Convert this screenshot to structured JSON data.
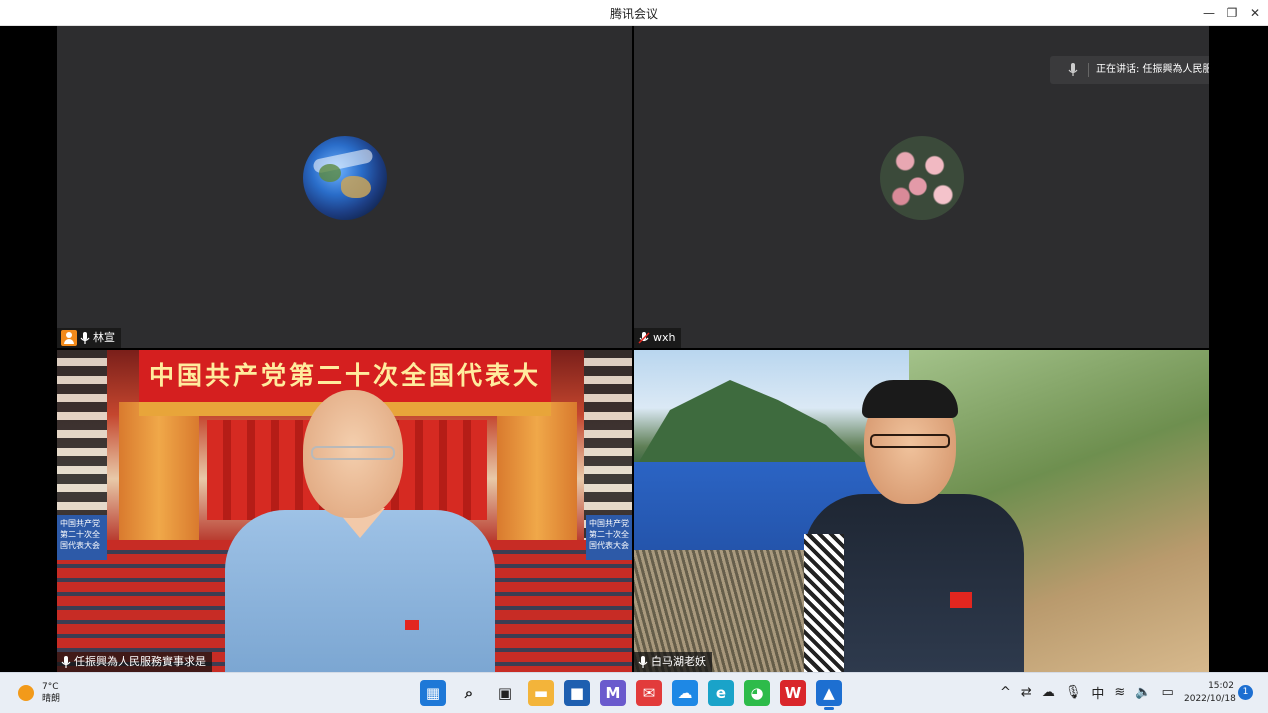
{
  "window": {
    "title": "腾讯会议",
    "minimize_glyph": "—",
    "maximize_glyph": "❐",
    "close_glyph": "✕"
  },
  "speaking": {
    "label": "正在讲话: 任振興為人民服務實..."
  },
  "participants": [
    {
      "name": "林宣",
      "avatar": "earth-avatar",
      "is_host": true
    },
    {
      "name": "wxh",
      "avatar": "flower-avatar",
      "is_host": false
    },
    {
      "name": "任振興為人民服務實事求是",
      "video": "congress-hall-background",
      "is_host": false
    },
    {
      "name": "白马湖老妖",
      "video": "lakeside-background",
      "is_host": false
    }
  ],
  "scene": {
    "banner": "中国共产党第二十次全国代表大会",
    "sign_left": "中国共产党第二十次全国代表大会",
    "sign_right": "中国共产党第二十次全国代表大会"
  },
  "taskbar": {
    "weather_temp": "7°C",
    "weather_desc": "晴朗",
    "apps": [
      {
        "name": "start-icon",
        "glyph": "▦",
        "color": "#1e78d7"
      },
      {
        "name": "search-icon",
        "glyph": "⌕",
        "color": "#222222"
      },
      {
        "name": "task-view-icon",
        "glyph": "▣",
        "color": "#222222"
      },
      {
        "name": "file-explorer-icon",
        "glyph": "▬",
        "color": "#f3b43a"
      },
      {
        "name": "store-icon",
        "glyph": "■",
        "color": "#1e5fb0"
      },
      {
        "name": "app-m-icon",
        "glyph": "M",
        "color": "#6a5acd"
      },
      {
        "name": "mail-app-icon",
        "glyph": "✉",
        "color": "#e23b3b"
      },
      {
        "name": "cloud-app-icon",
        "glyph": "☁",
        "color": "#1e88e5"
      },
      {
        "name": "edge-icon",
        "glyph": "e",
        "color": "#1aa3c9"
      },
      {
        "name": "wechat-icon",
        "glyph": "◕",
        "color": "#2dbb4a"
      },
      {
        "name": "wps-icon",
        "glyph": "W",
        "color": "#d9262b"
      },
      {
        "name": "tencent-meeting-icon",
        "glyph": "▲",
        "color": "#1d6fd1"
      }
    ],
    "ime": "中",
    "time": "15:02",
    "date": "2022/10/18",
    "notifications": "1"
  }
}
